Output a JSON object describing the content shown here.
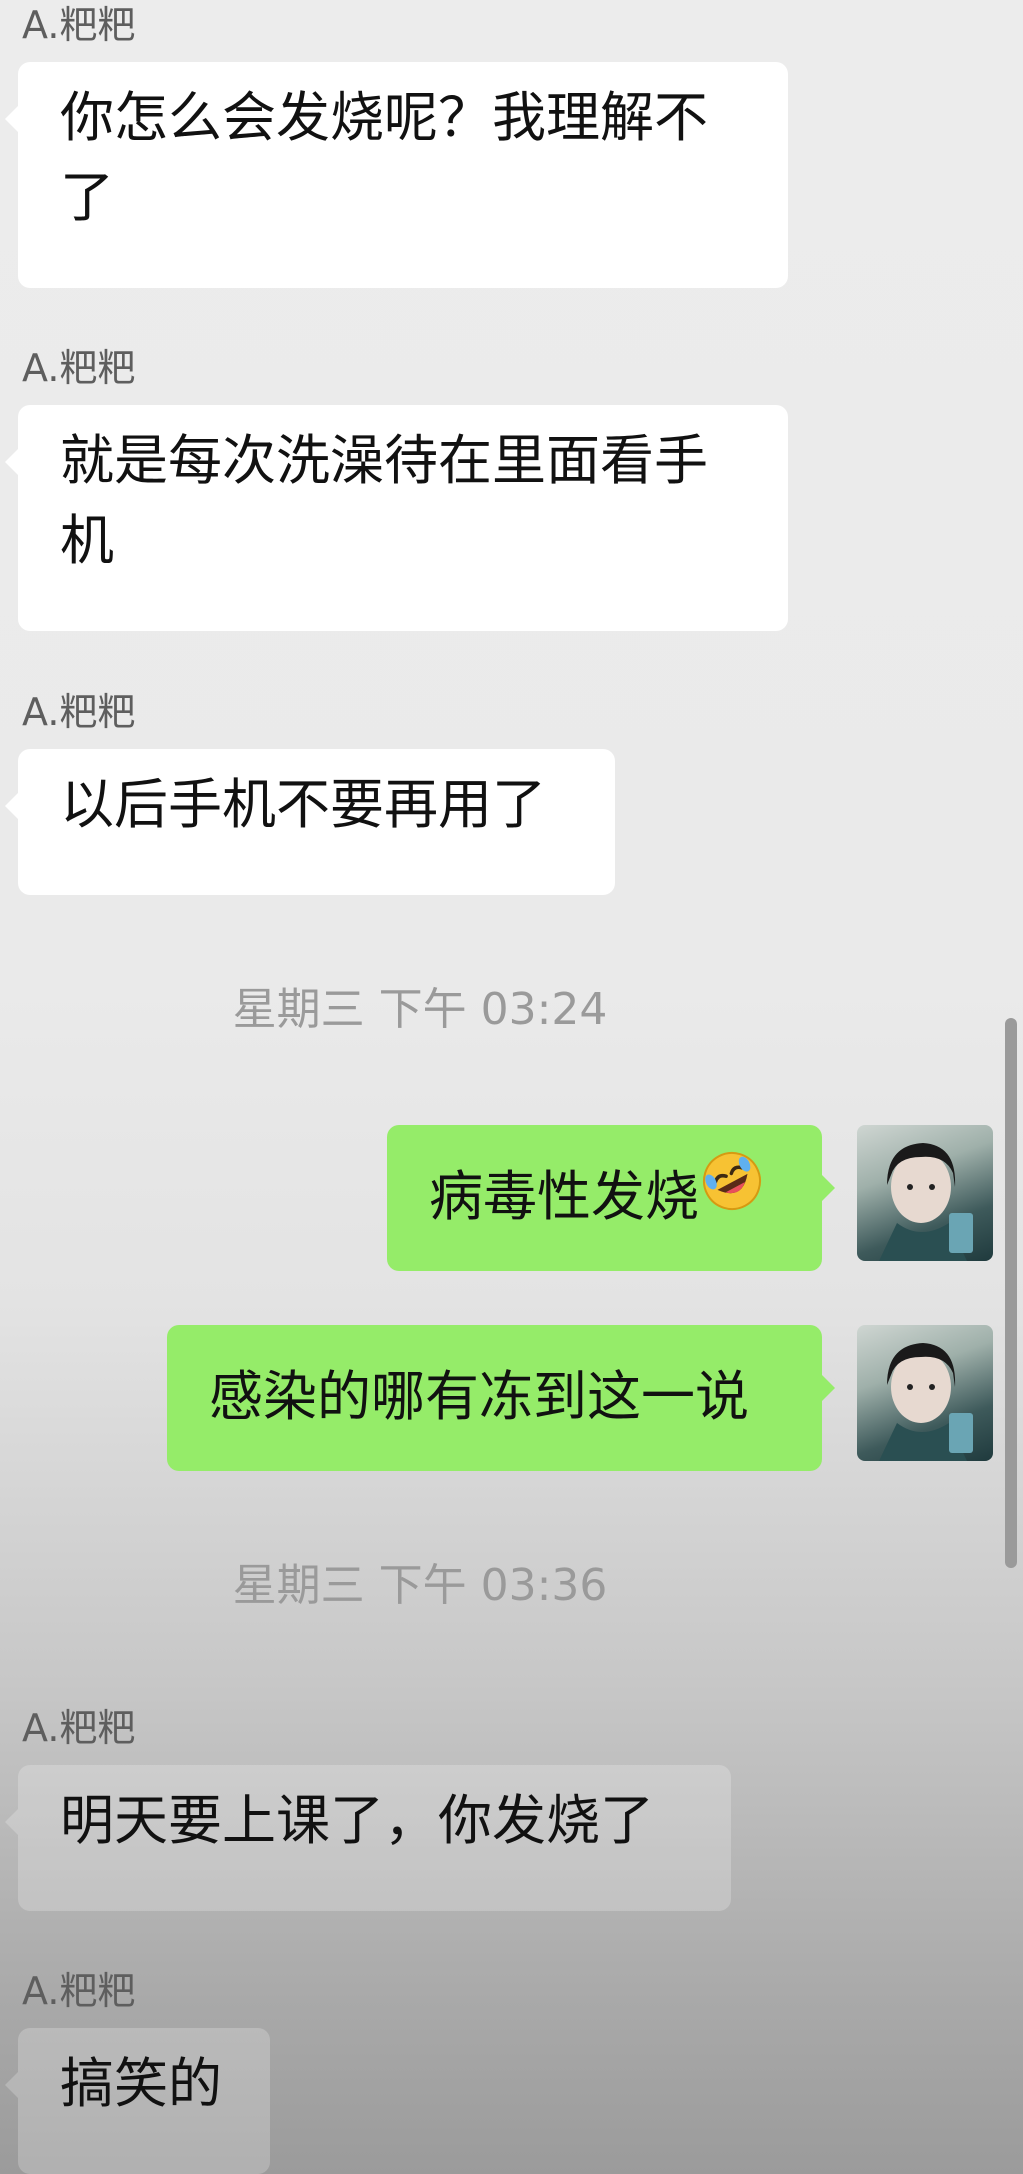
{
  "contact": {
    "name": "A.粑粑"
  },
  "messages": [
    {
      "sender_label": "A.粑粑",
      "text": "你怎么会发烧呢？我理解不了"
    },
    {
      "sender_label": "A.粑粑",
      "text": "就是每次洗澡待在里面看手机"
    },
    {
      "sender_label": "A.粑粑",
      "text": "以后手机不要再用了"
    },
    {
      "timestamp": "星期三 下午 03:24"
    },
    {
      "text": "病毒性发烧",
      "emoji": "rolling-on-floor-laughing-emoji"
    },
    {
      "text": "感染的哪有冻到这一说"
    },
    {
      "timestamp": "星期三 下午 03:36"
    },
    {
      "sender_label": "A.粑粑",
      "text": "明天要上课了，你发烧了"
    },
    {
      "sender_label": "A.粑粑",
      "text": "搞笑的"
    }
  ],
  "colors": {
    "incoming_bubble": "#ffffff",
    "outgoing_bubble": "#95ec69",
    "timestamp_text": "#9a9a9a",
    "sender_text": "#5e5e5e"
  }
}
